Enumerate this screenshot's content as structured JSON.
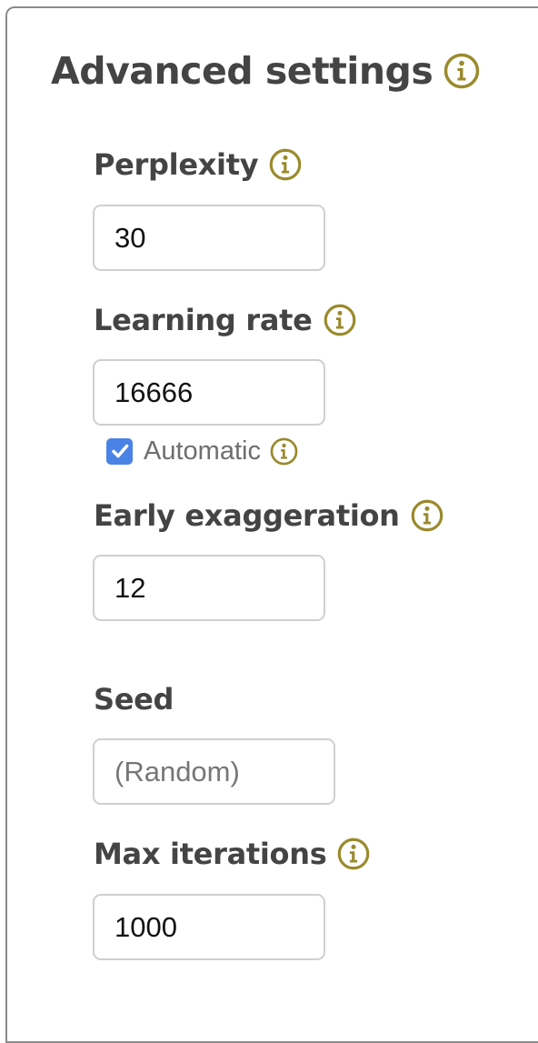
{
  "panel": {
    "title": "Advanced settings",
    "title_icon": "info-icon"
  },
  "fields": {
    "perplexity": {
      "label": "Perplexity",
      "value": "30",
      "icon": "info-icon"
    },
    "learning_rate": {
      "label": "Learning rate",
      "value": "16666",
      "icon": "info-icon",
      "automatic": {
        "label": "Automatic",
        "checked": true,
        "icon": "info-icon"
      }
    },
    "early_exaggeration": {
      "label": "Early exaggeration",
      "value": "12",
      "icon": "info-icon"
    },
    "seed": {
      "label": "Seed",
      "value": "",
      "placeholder": "(Random)"
    },
    "max_iterations": {
      "label": "Max iterations",
      "value": "1000",
      "icon": "info-icon"
    }
  },
  "colors": {
    "info_icon": "#9a8a2c",
    "label_text": "#444444",
    "checkbox_fill": "#4b82e6",
    "input_border": "#cfcfcf"
  }
}
